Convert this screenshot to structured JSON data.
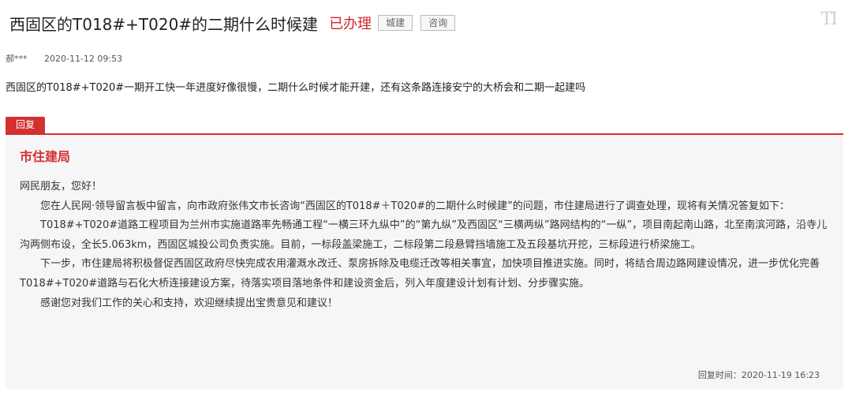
{
  "header": {
    "title": "西固区的T018#+T020#的二期什么时候建",
    "status": "已办理",
    "tags": [
      "城建",
      "咨询"
    ],
    "font_toggle": "TI"
  },
  "meta": {
    "author": "郝***",
    "date": "2020-11-12 09:53"
  },
  "question": "西固区的T018#+T020#一期开工快一年进度好像很慢，二期什么时候才能开建，还有这条路连接安宁的大桥会和二期一起建吗",
  "reply": {
    "tab_label": "回复",
    "org": "市住建局",
    "greeting": "网民朋友，您好！",
    "paragraphs": [
      "您在人民网·领导留言板中留言，向市政府张伟文市长咨询“西固区的T018#＋T020#的二期什么时候建”的问题，市住建局进行了调查处理，现将有关情况答复如下：",
      "T018#+T020#道路工程项目为兰州市实施道路率先畅通工程“一横三环九纵中”的“第九纵”及西固区“三横两纵”路网结构的“一纵”，项目南起南山路，北至南滨河路，沿寺儿沟两侧布设，全长5.063km，西固区城投公司负责实施。目前，一标段盖梁施工，二标段第二段悬臂挡墙施工及五段基坑开挖，三标段进行桥梁施工。",
      "下一步，市住建局将积极督促西固区政府尽快完成农用灌溉水改迁、泵房拆除及电缆迁改等相关事宜，加快项目推进实施。同时，将结合周边路网建设情况，进一步优化完善T018#+T020#道路与石化大桥连接建设方案，待落实项目落地条件和建设资金后，列入年度建设计划有计划、分步骤实施。",
      "感谢您对我们工作的关心和支持，欢迎继续提出宝贵意见和建议！"
    ],
    "time_label": "回复时间",
    "time": "2020-11-19 16:23"
  },
  "colors": {
    "accent_red": "#d43030",
    "status_red": "#d2262f",
    "reply_bg": "#f6f6f8"
  }
}
